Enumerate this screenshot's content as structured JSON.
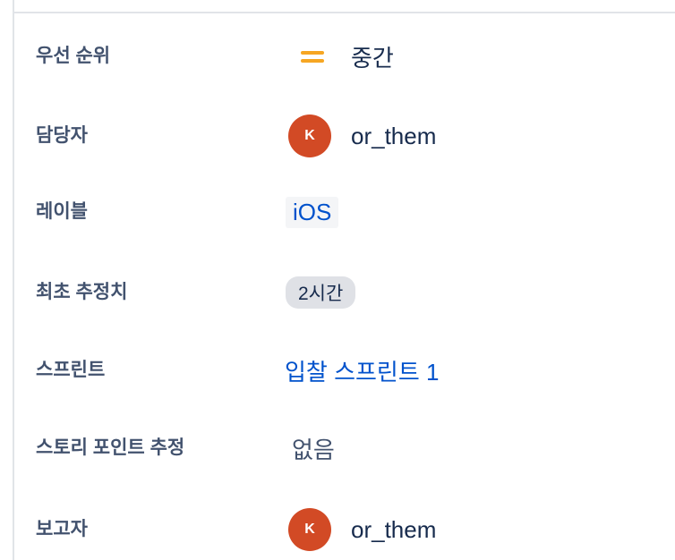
{
  "fields": {
    "priority": {
      "label": "우선 순위",
      "value": "중간",
      "icon": "priority-medium-icon",
      "color": "#f6a623"
    },
    "assignee": {
      "label": "담당자",
      "avatar_initial": "K",
      "name": "or_them",
      "avatar_color": "#d24a25"
    },
    "labels": {
      "label": "레이블",
      "value": "iOS"
    },
    "original_estimate": {
      "label": "최초 추정치",
      "value": "2시간"
    },
    "sprint": {
      "label": "스프린트",
      "value": "입찰 스프린트 1"
    },
    "story_points": {
      "label": "스토리 포인트 추정",
      "value": "없음"
    },
    "reporter": {
      "label": "보고자",
      "avatar_initial": "K",
      "name": "or_them",
      "avatar_color": "#d24a25"
    }
  }
}
